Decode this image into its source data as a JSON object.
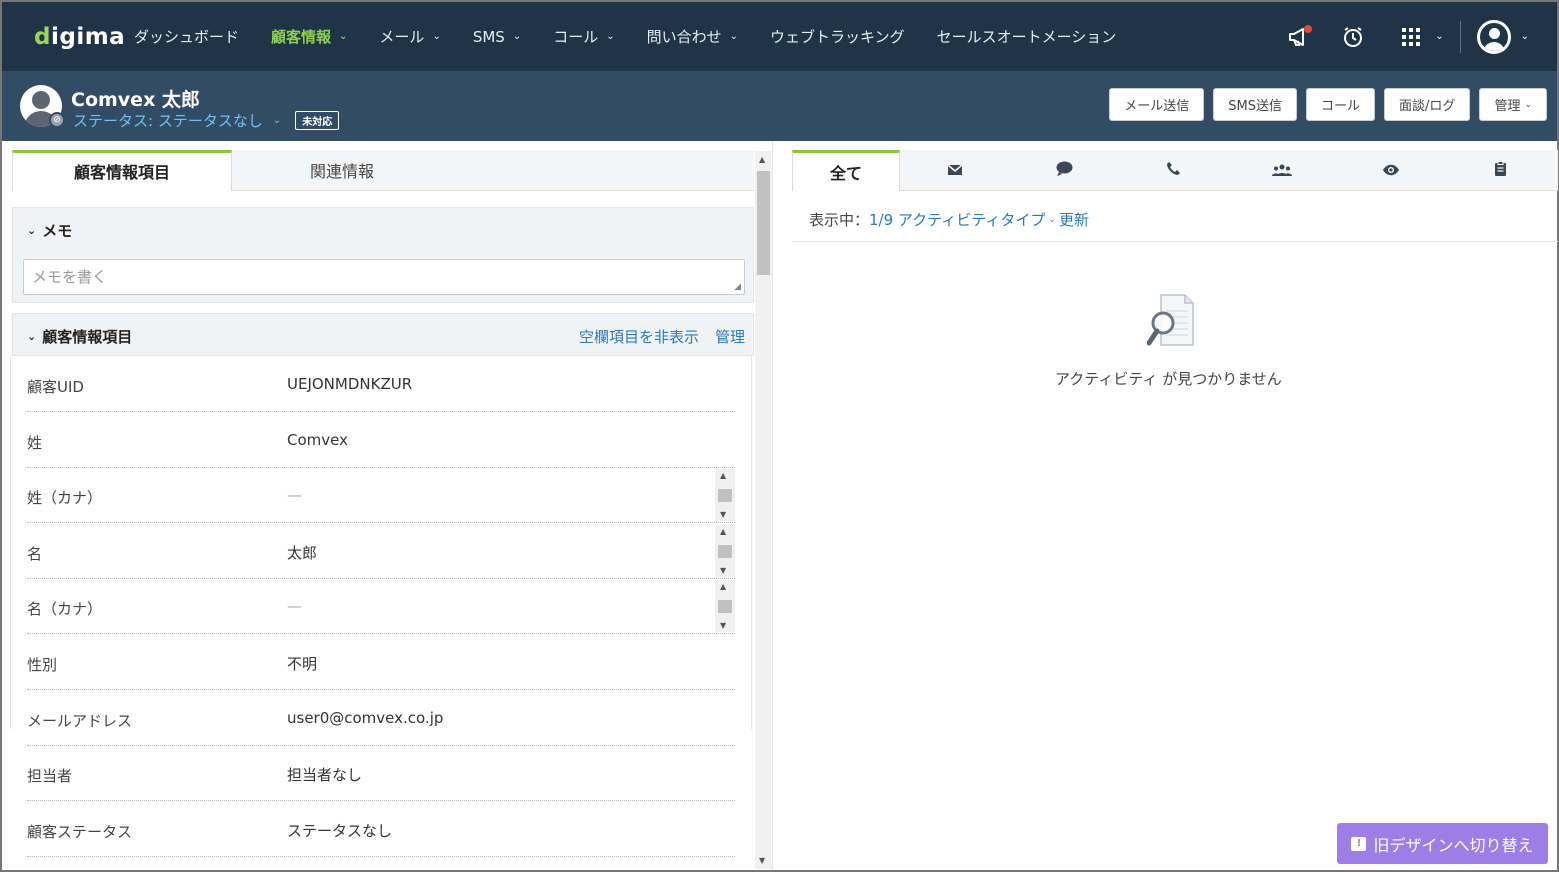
{
  "nav": {
    "logo": "digima",
    "items": [
      {
        "label": "ダッシュボード",
        "chevron": false,
        "active": false
      },
      {
        "label": "顧客情報",
        "chevron": true,
        "active": true
      },
      {
        "label": "メール",
        "chevron": true,
        "active": false
      },
      {
        "label": "SMS",
        "chevron": true,
        "active": false
      },
      {
        "label": "コール",
        "chevron": true,
        "active": false
      },
      {
        "label": "問い合わせ",
        "chevron": true,
        "active": false
      },
      {
        "label": "ウェブトラッキング",
        "chevron": false,
        "active": false
      },
      {
        "label": "セールスオートメーション",
        "chevron": false,
        "active": false
      }
    ],
    "icons": [
      "megaphone-icon",
      "alarm-clock-icon",
      "apps-grid-icon",
      "user-avatar-icon"
    ]
  },
  "customer": {
    "name": "Comvex 太郎",
    "status": "ステータス: ステータスなし",
    "tag": "未対応",
    "actions": [
      "メール送信",
      "SMS送信",
      "コール",
      "面談/ログ",
      "管理"
    ]
  },
  "left_tabs": [
    "顧客情報項目",
    "関連情報"
  ],
  "memo": {
    "title": "メモ",
    "placeholder": "メモを書く"
  },
  "info": {
    "title": "顧客情報項目",
    "hide_empty": "空欄項目を非表示",
    "manage": "管理",
    "rows": [
      {
        "label": "顧客UID",
        "value": "UEJONMDNKZUR"
      },
      {
        "label": "姓",
        "value": "Comvex"
      },
      {
        "label": "姓（カナ）",
        "value": "—"
      },
      {
        "label": "名",
        "value": "太郎"
      },
      {
        "label": "名（カナ）",
        "value": "—"
      },
      {
        "label": "性別",
        "value": "不明"
      },
      {
        "label": "メールアドレス",
        "value": "user0@comvex.co.jp"
      },
      {
        "label": "担当者",
        "value": "担当者なし"
      },
      {
        "label": "顧客ステータス",
        "value": "ステータスなし"
      }
    ]
  },
  "activity": {
    "tabs": [
      {
        "label": "全て",
        "icon": ""
      },
      {
        "label": "",
        "icon": "mail-icon"
      },
      {
        "label": "",
        "icon": "chat-icon"
      },
      {
        "label": "",
        "icon": "phone-icon"
      },
      {
        "label": "",
        "icon": "group-icon"
      },
      {
        "label": "",
        "icon": "eye-icon"
      },
      {
        "label": "",
        "icon": "clipboard-icon"
      }
    ],
    "showing_label": "表示中：",
    "filter": "1/9 アクティビティタイプ",
    "refresh": "更新",
    "empty": "アクティビティ が見つかりません",
    "switch_button": "旧デザインへ切り替え"
  },
  "colors": {
    "nav_bg": "#1f3447",
    "header_bg": "#324c65",
    "accent_green": "#8cc63f",
    "link_blue": "#2a7ab8",
    "switch_purple": "#9d7ee6"
  }
}
